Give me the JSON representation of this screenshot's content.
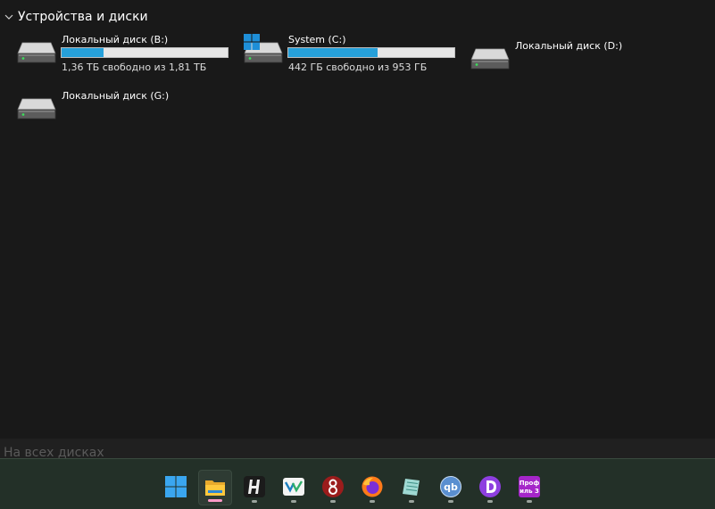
{
  "section": {
    "title": "Устройства и диски"
  },
  "drives": [
    {
      "name": "Локальный диск (B:)",
      "free_text": "1,36 ТБ свободно из 1,81 ТБ",
      "used_fraction": 0.25
    },
    {
      "name": "System (C:)",
      "free_text": "442 ГБ свободно из 953 ГБ",
      "used_fraction": 0.54
    },
    {
      "name": "Локальный диск (D:)"
    },
    {
      "name": "Локальный диск (G:)"
    }
  ],
  "statusbar": {
    "ghost_text": "На всех дисках"
  },
  "taskbar": {
    "items": [
      {
        "icon": "windows-start-icon"
      },
      {
        "icon": "file-explorer-icon",
        "active": true
      },
      {
        "icon": "h-app-icon"
      },
      {
        "icon": "vk-app-icon"
      },
      {
        "icon": "gnupg-app-icon"
      },
      {
        "icon": "firefox-icon"
      },
      {
        "icon": "notes-app-icon"
      },
      {
        "icon": "qbittorrent-icon"
      },
      {
        "icon": "d-app-icon"
      },
      {
        "icon": "profile-app-icon",
        "label": "Проф иль 3"
      }
    ]
  },
  "colors": {
    "background": "#191919",
    "bar_fill": "#26a0da",
    "bar_track": "#e6e6e6",
    "taskbar": "#233028",
    "active_indicator": "#ff9ac7"
  }
}
